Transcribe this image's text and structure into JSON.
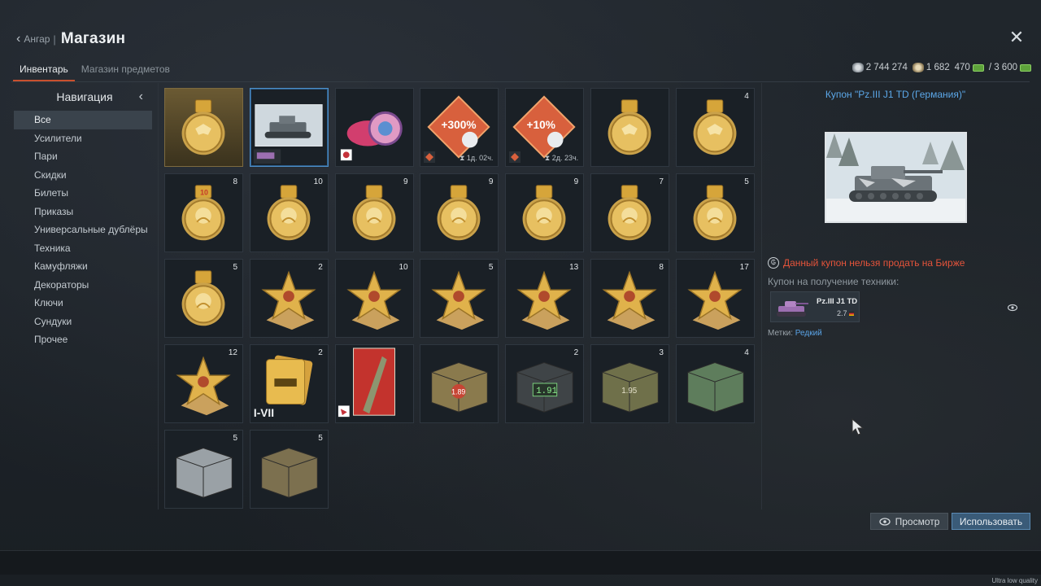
{
  "header": {
    "back_label": "Ангар",
    "separator": "|",
    "title": "Магазин"
  },
  "tabs": [
    {
      "label": "Инвентарь",
      "active": true
    },
    {
      "label": "Магазин предметов",
      "active": false
    }
  ],
  "currency": {
    "silver": "2 744 274",
    "gold": "1 682",
    "cash_current": "470",
    "cash_sep": "/ 3 600"
  },
  "nav": {
    "heading": "Навигация",
    "items": [
      {
        "label": "Все",
        "active": true
      },
      {
        "label": "Усилители"
      },
      {
        "label": "Пари"
      },
      {
        "label": "Скидки"
      },
      {
        "label": "Билеты"
      },
      {
        "label": "Приказы"
      },
      {
        "label": "Универсальные дублёры"
      },
      {
        "label": "Техника"
      },
      {
        "label": "Камуфляжи"
      },
      {
        "label": "Декораторы"
      },
      {
        "label": "Ключи"
      },
      {
        "label": "Сундуки"
      },
      {
        "label": "Прочее"
      }
    ]
  },
  "items": [
    {
      "icon": "medal-eagle-icon",
      "count": "",
      "gold_bg": true
    },
    {
      "icon": "tank-coupon-icon",
      "count": "",
      "selected": true
    },
    {
      "icon": "snail-decal-icon",
      "count": ""
    },
    {
      "icon": "booster-300-icon",
      "count": "",
      "label": "+300%",
      "timer": "1д. 02ч."
    },
    {
      "icon": "booster-10-icon",
      "count": "",
      "label": "+10%",
      "timer": "2д. 23ч."
    },
    {
      "icon": "medal-eagle-icon",
      "count": ""
    },
    {
      "icon": "medal-eagle-icon",
      "count": "4"
    },
    {
      "icon": "medal-lion-icon",
      "count": "8",
      "label": "10"
    },
    {
      "icon": "medal-lion-icon",
      "count": "10"
    },
    {
      "icon": "medal-lion-icon",
      "count": "9"
    },
    {
      "icon": "medal-lion-icon",
      "count": "9"
    },
    {
      "icon": "medal-lion-icon",
      "count": "9"
    },
    {
      "icon": "medal-lion-icon",
      "count": "7"
    },
    {
      "icon": "medal-lion-icon",
      "count": "5"
    },
    {
      "icon": "medal-lion-icon",
      "count": "5"
    },
    {
      "icon": "star-award-icon",
      "count": "2"
    },
    {
      "icon": "star-award-icon",
      "count": "10"
    },
    {
      "icon": "star-award-icon",
      "count": "5"
    },
    {
      "icon": "star-award-icon",
      "count": "13"
    },
    {
      "icon": "star-award-icon",
      "count": "8"
    },
    {
      "icon": "star-award-icon",
      "count": "17"
    },
    {
      "icon": "star-award-icon",
      "count": "12"
    },
    {
      "icon": "tank-cards-icon",
      "count": "2",
      "label": "I-VII"
    },
    {
      "icon": "poster-decal-icon",
      "count": ""
    },
    {
      "icon": "crate-wood-icon",
      "count": "",
      "label": "1.89"
    },
    {
      "icon": "crate-metal-icon",
      "count": "2",
      "label": "1.91"
    },
    {
      "icon": "crate-olive-icon",
      "count": "3",
      "label": "1.95"
    },
    {
      "icon": "crate-green-icon",
      "count": "4"
    },
    {
      "icon": "crate-silver-icon",
      "count": "5"
    },
    {
      "icon": "crate-camo-icon",
      "count": "5"
    }
  ],
  "detail": {
    "title": "Купон \"Pz.III J1 TD (Германия)\"",
    "warning": "Данный купон нельзя продать на Бирже",
    "coupon_label": "Купон на получение техники:",
    "vehicle_name": "Pz.III J1 TD",
    "vehicle_br": "2.7",
    "tags_label": "Метки:",
    "tags_value": "Редкий"
  },
  "buttons": {
    "view": "Просмотр",
    "use": "Использовать"
  },
  "footer": {
    "quality": "Ultra low quality"
  },
  "colors": {
    "accent_blue": "#5ba7e8",
    "warning_red": "#e4533a",
    "tab_underline": "#c9502e",
    "gold": "#d8a637"
  }
}
